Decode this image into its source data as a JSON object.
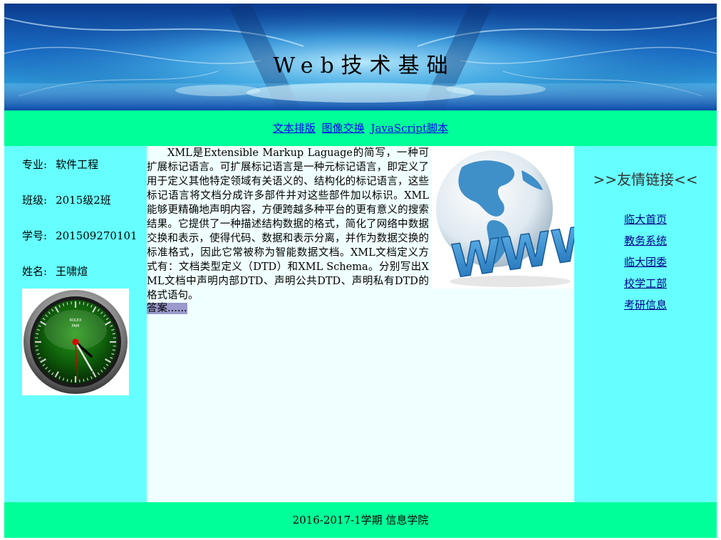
{
  "banner": {
    "title": "Web技术基础"
  },
  "nav": {
    "links": [
      {
        "label": "文本排版"
      },
      {
        "label": "图像交换"
      },
      {
        "label": "JavaScript脚本"
      }
    ]
  },
  "student": {
    "major_label": "专业:",
    "major": "软件工程",
    "class_label": "班级:",
    "class": "2015级2班",
    "id_label": "学号:",
    "id": "201509270101",
    "name_label": "姓名:",
    "name": "王啸煊"
  },
  "clock": {
    "brand": "ROLEX",
    "label": "PAM",
    "hour": 4,
    "minute": 25
  },
  "content": {
    "paragraph": "XML是Extensible Markup Laguage的简写，一种可扩展标记语言。可扩展标记语言是一种元标记语言，即定义了用于定义其他特定领域有关语义的、结构化的标记语言，这些标记语言将文档分成许多部件并对这些部件加以标识。XML能够更精确地声明内容，方便跨越多种平台的更有意义的搜索结果。它提供了一种描述结构数据的格式，简化了网络中数据交换和表示，使得代码、数据和表示分离，并作为数据交换的标准格式，因此它常被称为智能数据文档。XML文档定义方式有：文档类型定义（DTD）和XML Schema。分别写出XML文档中声明内部DTD、声明公共DTD、声明私有DTD的格式语句。",
    "answer": "答案......",
    "globe_text": "WWW"
  },
  "friend_links": {
    "title": ">>友情链接<<",
    "items": [
      {
        "label": "临大首页"
      },
      {
        "label": "教务系统"
      },
      {
        "label": "临大团委"
      },
      {
        "label": "校学工部"
      },
      {
        "label": "考研信息"
      }
    ]
  },
  "footer": {
    "text": "2016-2017-1学期 信息学院"
  },
  "colors": {
    "nav_bg": "#00ff99",
    "side_bg": "#66ffff",
    "content_bg": "#f0ffff",
    "answer_bg": "#9999cc",
    "link": "#0000ee"
  }
}
